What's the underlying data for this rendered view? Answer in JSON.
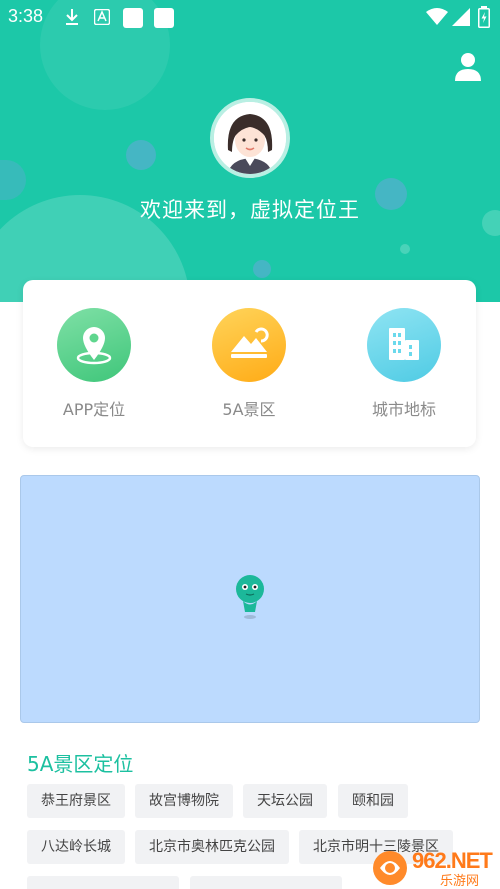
{
  "status_bar": {
    "time": "3:38",
    "icons": [
      "download-icon",
      "text-a-icon",
      "app-square-icon",
      "app-square-icon",
      "wifi-icon",
      "signal-icon",
      "battery-charging-icon"
    ]
  },
  "header": {
    "welcome": "欢迎来到，虚拟定位王",
    "profile_icon": "person-icon",
    "avatar_icon": "female-avatar-icon",
    "colors": {
      "primary": "#1cc8a8"
    }
  },
  "categories": [
    {
      "label": "APP定位",
      "icon": "location-pin-icon",
      "color": "#5fd68e"
    },
    {
      "label": "5A景区",
      "icon": "mountain-icon",
      "color": "#ffc22e"
    },
    {
      "label": "城市地标",
      "icon": "buildings-icon",
      "color": "#6bd9ec"
    }
  ],
  "map": {
    "marker_icon": "map-marker-icon",
    "background": "#bcdafe"
  },
  "section": {
    "title": "5A景区定位",
    "tags": [
      "恭王府景区",
      "故宫博物院",
      "天坛公园",
      "颐和园",
      "八达岭长城",
      "北京市奥林匹克公园",
      "北京市明十三陵景区"
    ]
  },
  "watermark": {
    "text": "962.NET",
    "sub": "乐游网"
  }
}
